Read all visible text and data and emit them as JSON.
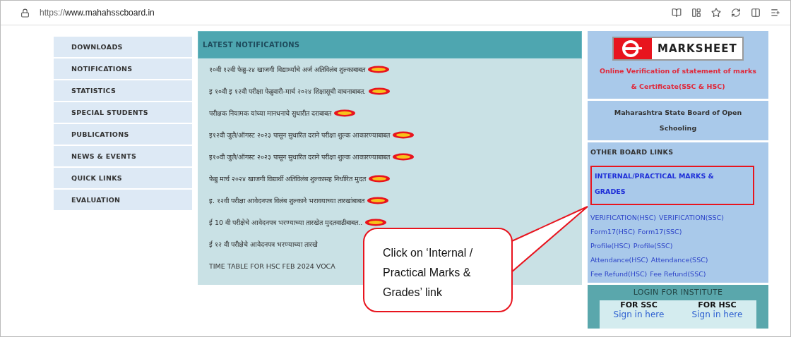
{
  "browser": {
    "url_prefix": "https://",
    "url_host": "www.mahahsscboard.in"
  },
  "side_menu": [
    {
      "label": "DOWNLOADS"
    },
    {
      "label": "NOTIFICATIONS"
    },
    {
      "label": "STATISTICS"
    },
    {
      "label": "SPECIAL STUDENTS"
    },
    {
      "label": "PUBLICATIONS"
    },
    {
      "label": "NEWS & EVENTS"
    },
    {
      "label": "QUICK LINKS"
    },
    {
      "label": "EVALUATION"
    }
  ],
  "notifications": {
    "title": "LATEST NOTIFICATIONS",
    "items": [
      {
        "text": "१०वी १२वी फेब्रु-२४ खाजगी विद्यार्थ्यांचे अर्ज अतिविलंब शुल्काबाबत",
        "new": true
      },
      {
        "text": "इ १०वी इ १२वी परीक्षा फेब्रुवारी-मार्च २०२४ शिक्षासूची वाचनाबाबत.",
        "new": true
      },
      {
        "text": "परीक्षक नियामक यांच्या मानधनाचे सुधारीत दराबाबत",
        "new": true
      },
      {
        "text": "इ१२वी जुलै/ऑगस्ट २०२३ पासून सुधारित दराने परीक्षा शुल्क आकारण्याबाबत",
        "new": true
      },
      {
        "text": "इ१०वी जुलै/ऑगस्ट २०२३ पासून सुधारित दराने परीक्षा शुल्क आकारण्याबाबत",
        "new": true
      },
      {
        "text": "फेब्रु मार्च २०२४ खाजगी विद्यार्थी अतिविलंब शुल्कासह निर्धारित मुदत",
        "new": true
      },
      {
        "text": "इ. १२वी परीक्षा आवेदनपत्र विलंब शुल्काने भरावयाच्या तारखांबाबत",
        "new": true
      },
      {
        "text": "ई 10 वी परीक्षेचे आवेदनपत्र भरण्याच्या तारखेत मुदतवाढीबाबत..",
        "new": true
      },
      {
        "text": "ई १२ वी परीक्षेचे आवेदनपत्र भरण्याच्या तारखे",
        "new": false
      },
      {
        "text": "TIME TABLE FOR HSC FEB 2024 VOCA",
        "new": false
      }
    ]
  },
  "right_panel": {
    "logo_text": "MARKSHEET",
    "verification_text": "Online Verification of statement of marks & Certificate(SSC & HSC)",
    "open_schooling": "Maharashtra State Board of Open Schooling",
    "other_links_title": "OTHER BOARD LINKS",
    "internal_link": {
      "label": "INTERNAL/PRACTICAL MARKS & GRADES",
      "highlighted": true
    },
    "link_rows": [
      [
        "VERIFICATION(HSC)",
        "VERIFICATION(SSC)"
      ],
      [
        "Form17(HSC)",
        "Form17(SSC)"
      ],
      [
        "Profile(HSC)",
        "Profile(SSC)"
      ],
      [
        "Attendance(HSC)",
        "Attendance(SSC)"
      ],
      [
        "Fee Refund(HSC)",
        "Fee Refund(SSC)"
      ]
    ],
    "login": {
      "title": "LOGIN FOR INSTITUTE",
      "columns": [
        {
          "heading": "FOR SSC",
          "link": "Sign in here"
        },
        {
          "heading": "FOR HSC",
          "link": "Sign in here"
        }
      ]
    }
  },
  "callout": {
    "text": "Click on ‘Internal / Practical Marks & Grades’ link"
  }
}
